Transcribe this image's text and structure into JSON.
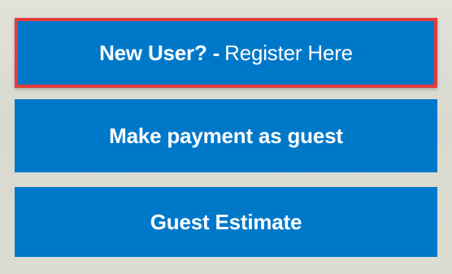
{
  "buttons": {
    "register": {
      "bold_text": "New User? -",
      "normal_text": "Register Here"
    },
    "guest_payment": {
      "label": "Make payment as guest"
    },
    "guest_estimate": {
      "label": "Guest Estimate"
    }
  },
  "colors": {
    "button_bg": "#0078c9",
    "highlight_border": "#e33b3b",
    "page_bg": "#d8d9cf"
  }
}
